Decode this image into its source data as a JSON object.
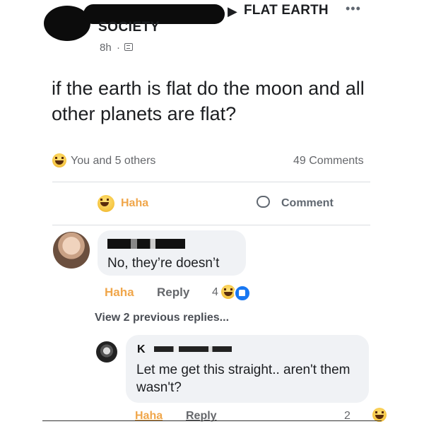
{
  "header": {
    "group_name": "FLAT EARTH",
    "group_arrow": "▶",
    "more_icon": "•••",
    "author_suffix": "SOCIETY",
    "time": "8h",
    "separator": "·",
    "audience_icon": "globe-icon"
  },
  "post": {
    "text": "if the earth is flat do the moon and all other planets are flat?"
  },
  "reactions": {
    "summary": "You and 5 others",
    "comments_count": "49 Comments",
    "emoji": "haha-emoji"
  },
  "actions": {
    "haha_label": "Haha",
    "comment_label": "Comment"
  },
  "comment1": {
    "text": "No, they’re doesn’t",
    "haha_label": "Haha",
    "reply_label": "Reply",
    "reaction_count": "4"
  },
  "view_replies": "View 2 previous replies...",
  "comment2": {
    "author": "K",
    "text": "Let me get this straight.. aren't them wasn't?",
    "haha_label": "Haha",
    "reply_label": "Reply",
    "reaction_count": "2"
  },
  "colors": {
    "haha": "#f0a64a",
    "muted": "#65676b",
    "bubble": "#f0f2f5",
    "like_blue": "#1877f2"
  }
}
